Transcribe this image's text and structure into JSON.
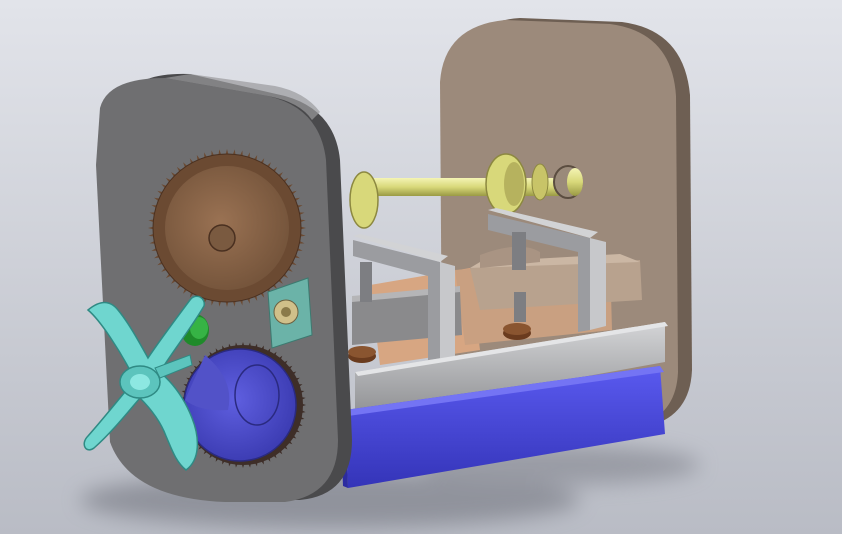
{
  "colors": {
    "background_top": "#e2e4ea",
    "background_bottom": "#b9bcc5",
    "front_plate": "#6f6f71",
    "front_plate_edge": "#4a4a4c",
    "rear_plate": "#9c8a7b",
    "rear_plate_edge": "#6e5f53",
    "large_gear": "#8a6448",
    "large_gear_teeth": "#6b4a32",
    "shaft": "#d8d87a",
    "shaft_collar": "#c8c468",
    "maltese_cross": "#6fd6cf",
    "blue_disc": "#4949c8",
    "blue_bar": "#4a4ae0",
    "bracket": "#a9aaae",
    "block": "#b8a28e",
    "copper_block": "#d7a682",
    "slide_rail": "#b5b6b8",
    "pinion_green": "#1f8a2a",
    "small_gear_board": "#6bb3a8",
    "ring_brown": "#6a3b1e"
  }
}
